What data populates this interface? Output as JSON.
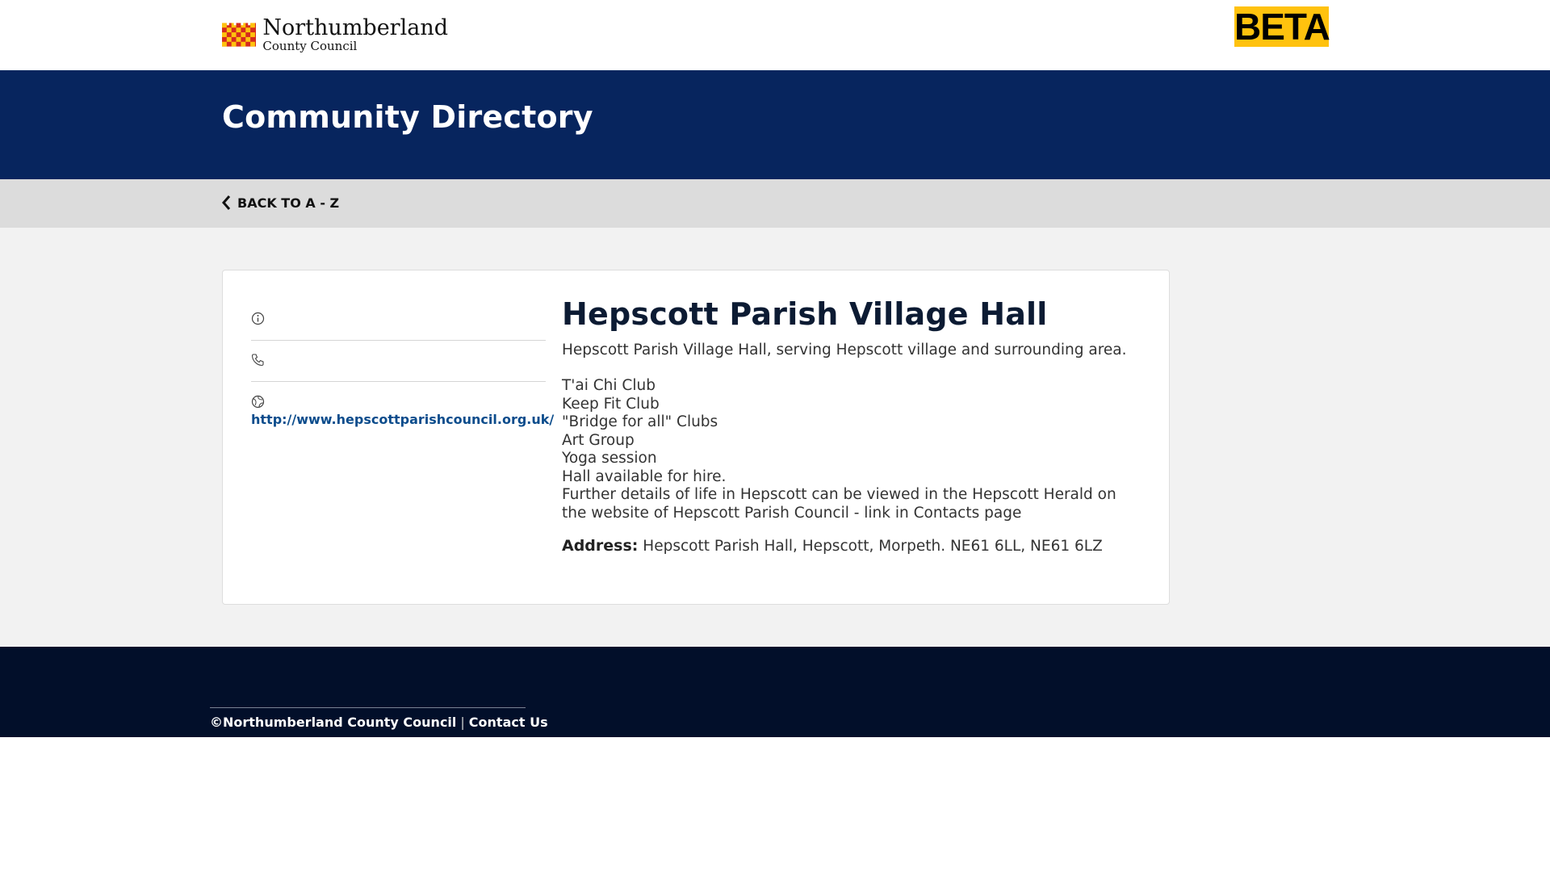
{
  "header": {
    "logo": {
      "name": "Northumberland",
      "sub": "County Council",
      "colors": [
        "#d52b1e",
        "#ffc20e"
      ]
    },
    "beta_label": "BETA"
  },
  "hero": {
    "title": "Community Directory",
    "background": "#07255e"
  },
  "nav": {
    "back_label": "BACK TO A - Z",
    "back_icon": "chevron-left-icon"
  },
  "listing": {
    "title": "Hepscott Parish Village Hall",
    "contacts": [
      {
        "icon": "info-icon",
        "value": ""
      },
      {
        "icon": "phone-icon",
        "value": ""
      },
      {
        "icon": "globe-icon",
        "value": "http://www.hepscottparishcouncil.org.uk/"
      }
    ],
    "description_intro": "Hepscott Parish Village Hall, serving Hepscott village and surrounding area.",
    "description_lines": [
      "T'ai Chi Club",
      "Keep Fit Club",
      "\"Bridge for all\" Clubs",
      "Art Group",
      "Yoga session",
      "Hall available for hire.",
      "Further details of life in Hepscott can be viewed in the Hepscott Herald on the website of Hepscott Parish Council - link in Contacts page"
    ],
    "address_label": "Address:",
    "address_value": "Hepscott Parish Hall, Hepscott, Morpeth. NE61 6LL, NE61 6LZ"
  },
  "footer": {
    "copyright": "©Northumberland County Council",
    "separator": "|",
    "contact_label": "Contact Us"
  }
}
